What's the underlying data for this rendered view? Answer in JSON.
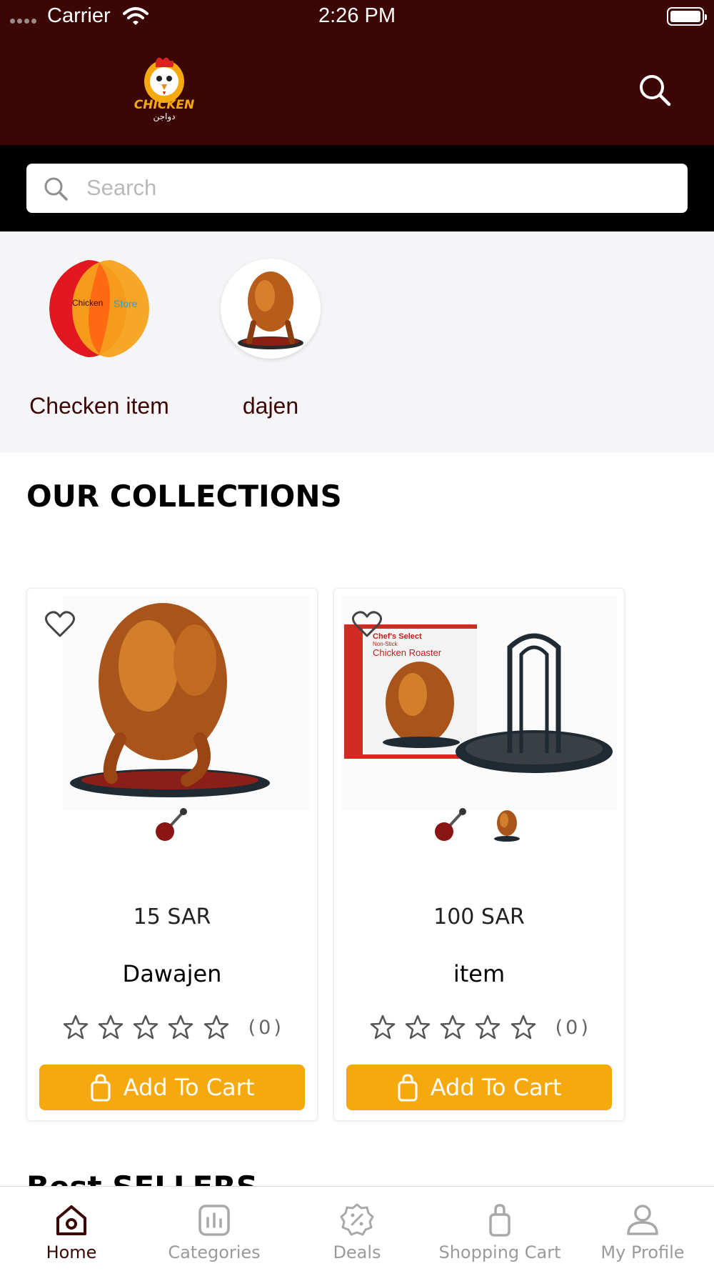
{
  "status_bar": {
    "carrier": "Carrier",
    "time": "2:26 PM"
  },
  "header": {
    "logo_text": "CHICKEN",
    "logo_arabic": "دواجن",
    "search_icon": "search-icon"
  },
  "search": {
    "placeholder": "Search"
  },
  "categories": [
    {
      "label": "Checken item",
      "image": "chicken-store-logo",
      "image_text_left": "Chicken",
      "image_text_right": "Store"
    },
    {
      "label": "dajen",
      "image": "roast-chicken-photo"
    }
  ],
  "collections": {
    "title": "OUR COLLECTIONS",
    "products": [
      {
        "price": "15 SAR",
        "name": "Dawajen",
        "rating": 0,
        "rating_count": "(0)",
        "cart_label": "Add To Cart",
        "thumbs": [
          "roaster-stand-thumb"
        ]
      },
      {
        "price": "100 SAR",
        "name": "item",
        "rating": 0,
        "rating_count": "(0)",
        "cart_label": "Add To Cart",
        "thumbs": [
          "roaster-stand-thumb",
          "roast-chicken-thumb"
        ],
        "box_title": "Chef's Select",
        "box_subtitle": "Non-Stick",
        "box_name": "Chicken Roaster"
      }
    ]
  },
  "next_section": {
    "title": "Best SELLERS"
  },
  "tab_bar": {
    "active": "home",
    "tabs": [
      {
        "label": "Home",
        "icon": "home-icon"
      },
      {
        "label": "Categories",
        "icon": "categories-icon"
      },
      {
        "label": "Deals",
        "icon": "deals-icon"
      },
      {
        "label": "Shopping Cart",
        "icon": "shopping-bag-icon"
      },
      {
        "label": "My Profile",
        "icon": "profile-icon"
      }
    ]
  },
  "colors": {
    "brand_dark": "#3b0604",
    "accent": "#f6a90f",
    "search_band": "#000000"
  }
}
